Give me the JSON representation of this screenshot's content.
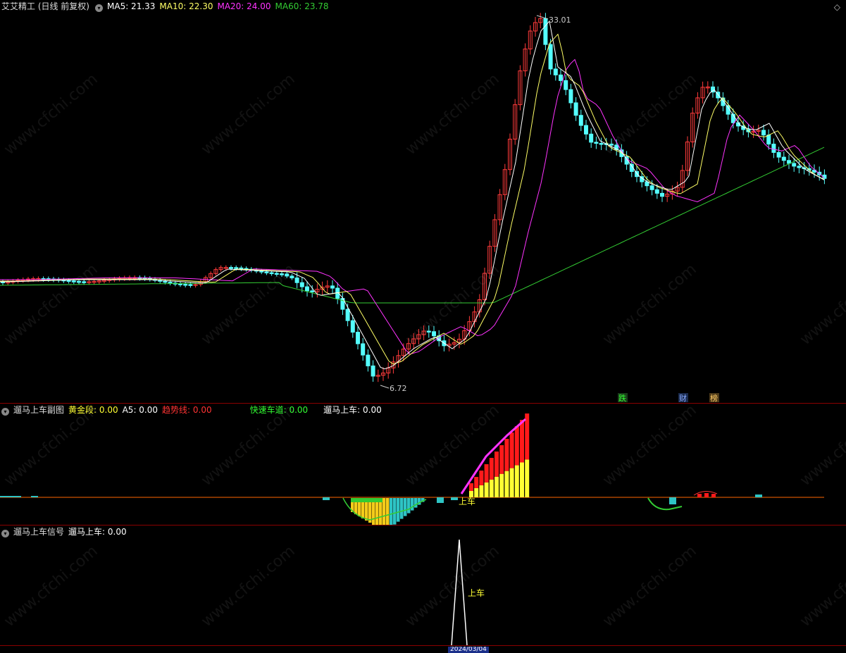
{
  "main": {
    "title": "艾艾精工 (日线 前复权)",
    "ma5_label": "MA5: 21.33",
    "ma10_label": "MA10: 22.30",
    "ma20_label": "MA20: 24.00",
    "ma60_label": "MA60: 23.78",
    "high_label": "33.01",
    "low_label": "6.72",
    "badges": [
      "跌",
      "财",
      "榜"
    ],
    "colors": {
      "up": "#ff3b3b",
      "down": "#54ffff",
      "ma5": "#ffffff",
      "ma10": "#ffff66",
      "ma20": "#ff33ff",
      "ma60": "#33cc33"
    }
  },
  "sub1": {
    "title": "遛马上车副图",
    "gold_label": "黄金段: 0.00",
    "a5_label": "A5: 0.00",
    "trend_label": "趋势线: 0.00",
    "fast_label": "快速车道: 0.00",
    "signal_label": "遛马上车: 0.00",
    "marker_label": "上车"
  },
  "sub2": {
    "title": "遛马上车信号",
    "signal_label": "遛马上车: 0.00",
    "marker_label": "上车"
  },
  "footer": {
    "date_label": "2024/03/04"
  },
  "watermark": "www.cfchi.com",
  "chart_data": {
    "type": "candlestick",
    "price_range": [
      6.72,
      33.01
    ],
    "high": 33.01,
    "low": 6.72,
    "moving_averages": [
      {
        "name": "MA5",
        "value": 21.33
      },
      {
        "name": "MA10",
        "value": 22.3
      },
      {
        "name": "MA20",
        "value": 24.0
      },
      {
        "name": "MA60",
        "value": 23.78
      }
    ]
  }
}
